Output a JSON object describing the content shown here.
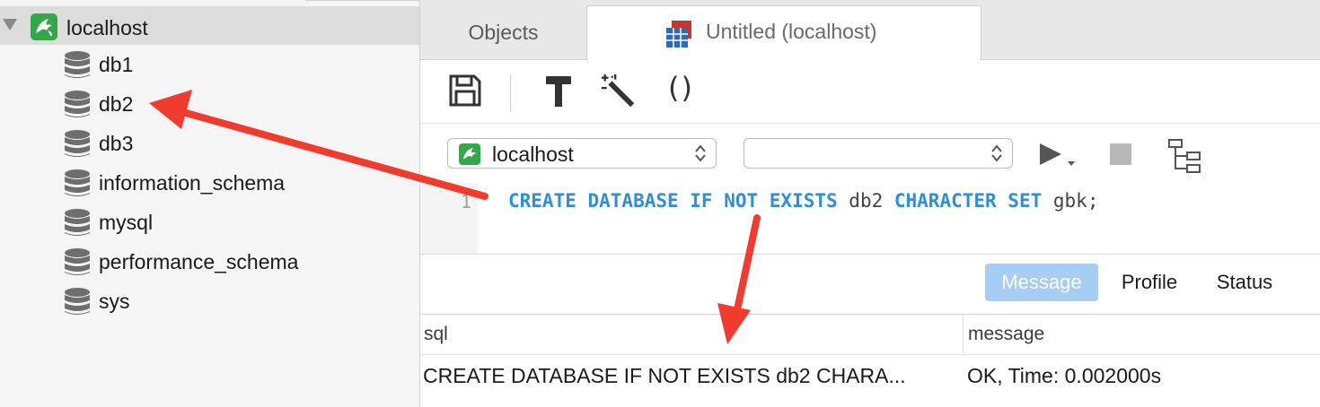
{
  "sidebar": {
    "connection": {
      "label": "localhost",
      "icon": "mysql-dolphin-icon"
    },
    "databases": [
      {
        "label": "db1"
      },
      {
        "label": "db2"
      },
      {
        "label": "db3"
      },
      {
        "label": "information_schema"
      },
      {
        "label": "mysql"
      },
      {
        "label": "performance_schema"
      },
      {
        "label": "sys"
      }
    ]
  },
  "tabs": {
    "objects": "Objects",
    "query": "Untitled (localhost)"
  },
  "selectors": {
    "connection": "localhost",
    "database": ""
  },
  "editor": {
    "line_number": "1",
    "tokens": {
      "t1": "CREATE DATABASE IF NOT EXISTS",
      "t2": " db2 ",
      "t3": "CHARACTER SET",
      "t4": " gbk;"
    }
  },
  "result_tabs": {
    "message": "Message",
    "profile": "Profile",
    "status": "Status"
  },
  "result_table": {
    "columns": [
      "sql",
      "message"
    ],
    "rows": [
      [
        "CREATE DATABASE IF NOT EXISTS db2 CHARA...",
        "OK, Time: 0.002000s"
      ]
    ]
  },
  "colors": {
    "keyword": "#2e8fd6",
    "mysql_green": "#34a74b",
    "active_result_tab": "#a8cdf3",
    "annotation_arrow": "#f23b2f"
  }
}
